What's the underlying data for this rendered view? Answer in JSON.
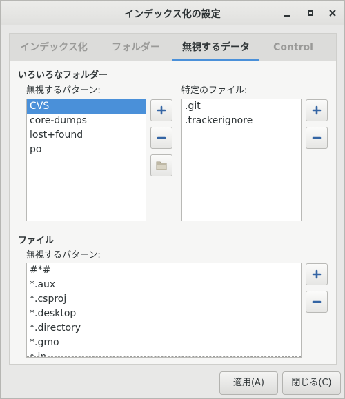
{
  "window": {
    "title": "インデックス化の設定"
  },
  "tabs": [
    {
      "label": "インデックス化",
      "active": false
    },
    {
      "label": "フォルダー",
      "active": false
    },
    {
      "label": "無視するデータ",
      "active": true
    },
    {
      "label": "Control",
      "active": false
    }
  ],
  "folders_section": {
    "title": "いろいろなフォルダー",
    "patterns_label": "無視するパターン:",
    "patterns": [
      "CVS",
      "core-dumps",
      "lost+found",
      "po"
    ],
    "selected_index": 0,
    "specific_files_label": "特定のファイル:",
    "specific_files": [
      ".git",
      ".trackerignore"
    ]
  },
  "files_section": {
    "title": "ファイル",
    "patterns_label": "無視するパターン:",
    "patterns": [
      "#*#",
      "*.aux",
      "*.csproj",
      "*.desktop",
      "*.directory",
      "*.gmo",
      "*.in"
    ]
  },
  "footer": {
    "apply_label": "適用(A)",
    "close_label": "閉じる(C)"
  },
  "colors": {
    "accent": "#4a90d9",
    "plus_icon": "#3465a4",
    "minus_icon": "#3465a4"
  }
}
